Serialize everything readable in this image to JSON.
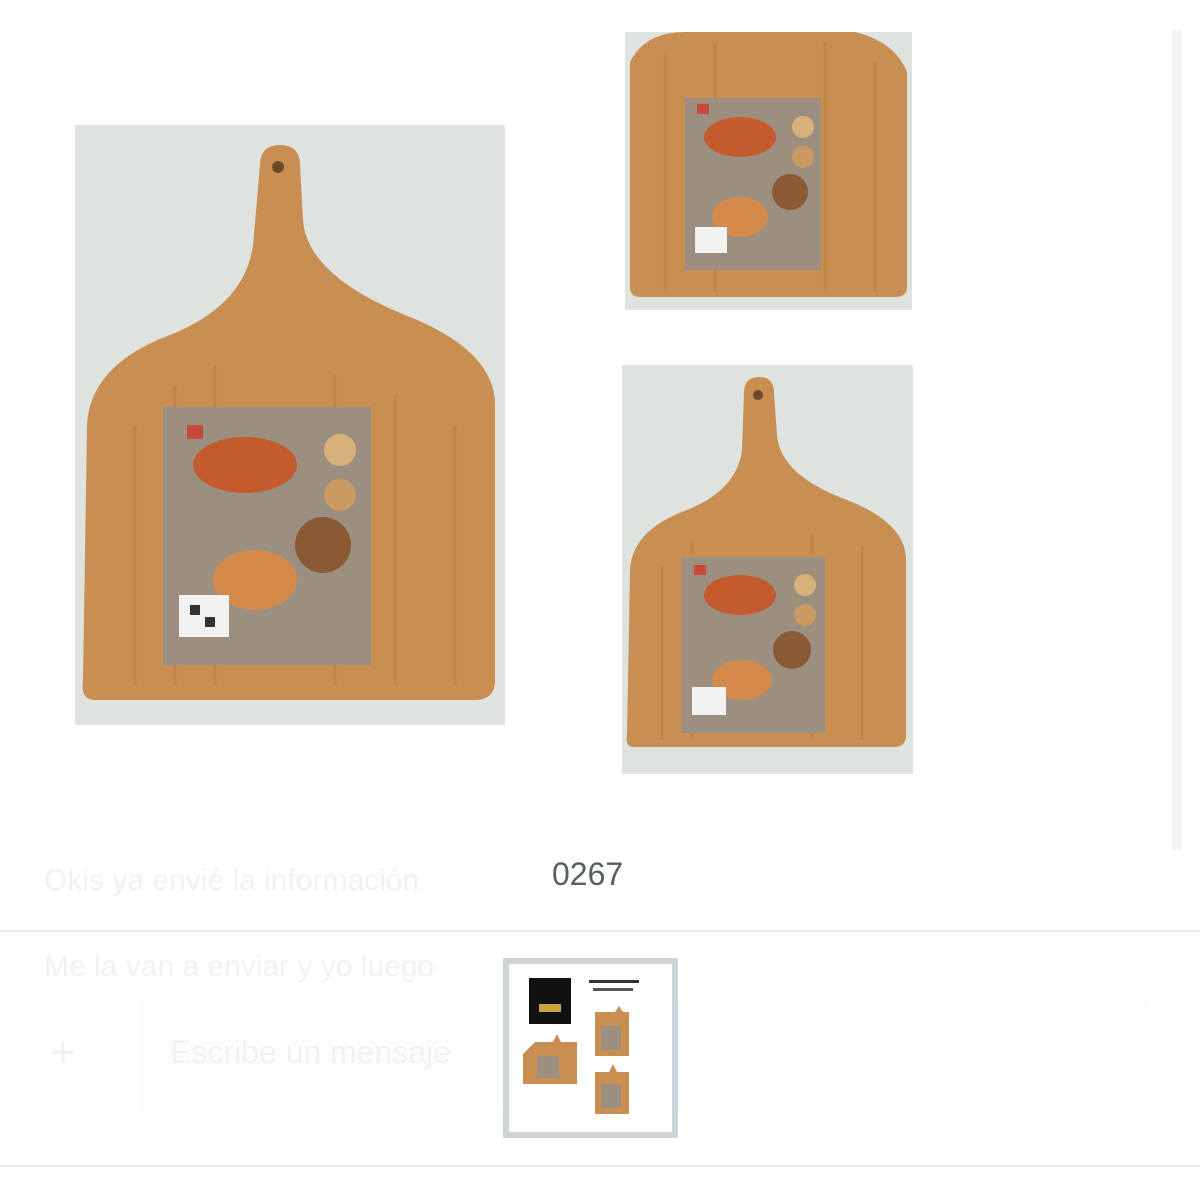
{
  "chat": {
    "message_1": "Okis ya envié la información",
    "message_2": "Me la van a enviar y yo luego",
    "input_placeholder": "Escribe un mensaje",
    "attach_label": "+"
  },
  "viewer": {
    "caption": "0267",
    "photos": [
      {
        "name": "cutting-board-large",
        "description_icon": "cutting-board-icon"
      },
      {
        "name": "cutting-board-top-right",
        "description_icon": "cutting-board-icon"
      },
      {
        "name": "cutting-board-bottom-right",
        "description_icon": "cutting-board-icon"
      }
    ],
    "thumbnail": {
      "name": "gallery-thumbnail"
    }
  },
  "colors": {
    "wood": "#c98f52",
    "wood_dark": "#b57a3f",
    "photo_bg": "#dfe3df",
    "caption": "#555e64",
    "thumb_border": "#cfd4d8"
  }
}
